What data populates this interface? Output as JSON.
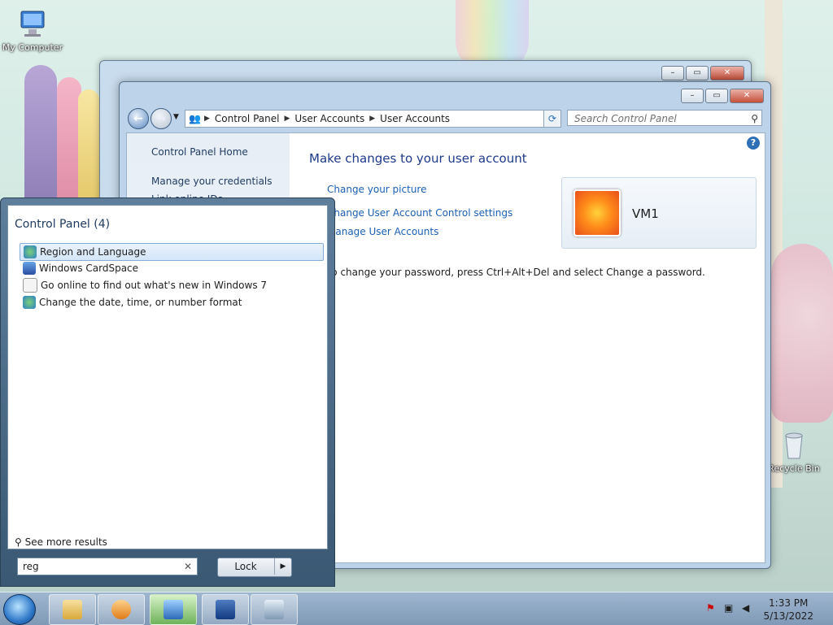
{
  "desktop": {
    "icons": [
      {
        "label": "My Computer"
      },
      {
        "label": "Recycle Bin"
      }
    ]
  },
  "main_window": {
    "address": [
      "Control Panel",
      "User Accounts",
      "User Accounts"
    ],
    "search_placeholder": "Search Control Panel",
    "left_links": [
      "Control Panel Home",
      "Manage your credentials",
      "Link online IDs"
    ],
    "heading": "Make changes to your user account",
    "links": [
      "Change your picture",
      "Change User Account Control settings",
      "Manage User Accounts"
    ],
    "password_note": "To change your password, press Ctrl+Alt+Del and select Change a password.",
    "account_name": "VM1"
  },
  "start_menu": {
    "group_header": "Control Panel (4)",
    "results": [
      {
        "label": "Region and Language",
        "icon": "globe-icon",
        "selected": true
      },
      {
        "label": "Windows CardSpace",
        "icon": "cardspace-icon",
        "selected": false
      },
      {
        "label": "Go online to find out what's new in Windows 7",
        "icon": "document-icon",
        "selected": false
      },
      {
        "label": "Change the date, time, or number format",
        "icon": "globe-icon",
        "selected": false
      }
    ],
    "see_more": "See more results",
    "search_value": "reg",
    "lock_label": "Lock"
  },
  "taskbar": {
    "time": "1:33 PM",
    "date": "5/13/2022"
  },
  "colors": {
    "link": "#1a5fb4",
    "heading": "#1e3a8a",
    "taskbar": "#8ea8c4"
  }
}
